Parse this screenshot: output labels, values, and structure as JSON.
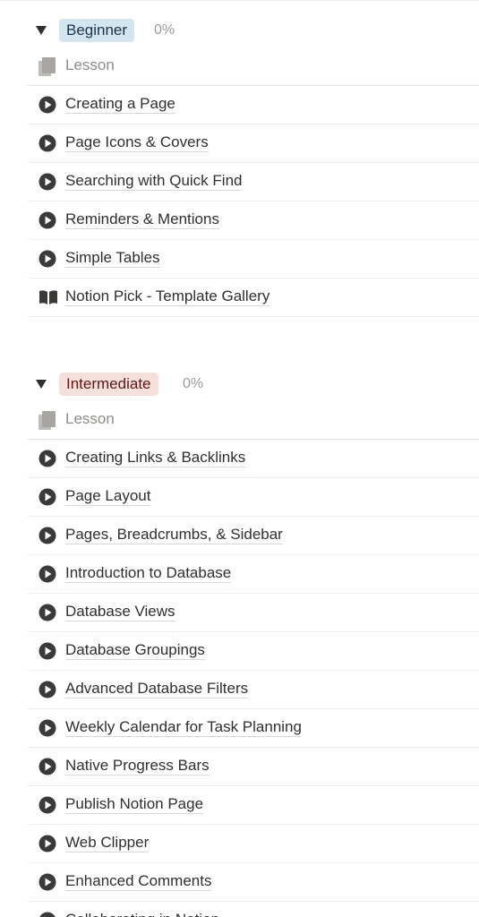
{
  "groups": [
    {
      "tag": "Beginner",
      "progress": "0%",
      "column_header": "Lesson",
      "items": [
        {
          "title": "Creating a Page",
          "icon": "play-circle-icon"
        },
        {
          "title": "Page Icons & Covers",
          "icon": "play-circle-icon"
        },
        {
          "title": "Searching with Quick Find",
          "icon": "play-circle-icon"
        },
        {
          "title": "Reminders & Mentions",
          "icon": "play-circle-icon"
        },
        {
          "title": "Simple Tables",
          "icon": "play-circle-icon"
        },
        {
          "title": "Notion Pick - Template Gallery",
          "icon": "open-book-icon"
        }
      ]
    },
    {
      "tag": "Intermediate",
      "progress": "0%",
      "column_header": "Lesson",
      "items": [
        {
          "title": "Creating Links & Backlinks",
          "icon": "play-circle-icon"
        },
        {
          "title": "Page Layout",
          "icon": "play-circle-icon"
        },
        {
          "title": "Pages, Breadcrumbs, & Sidebar",
          "icon": "play-circle-icon"
        },
        {
          "title": "Introduction to Database",
          "icon": "play-circle-icon"
        },
        {
          "title": "Database Views",
          "icon": "play-circle-icon"
        },
        {
          "title": "Database Groupings",
          "icon": "play-circle-icon"
        },
        {
          "title": "Advanced Database Filters",
          "icon": "play-circle-icon"
        },
        {
          "title": "Weekly Calendar for Task Planning",
          "icon": "play-circle-icon"
        },
        {
          "title": "Native Progress Bars",
          "icon": "play-circle-icon"
        },
        {
          "title": "Publish Notion Page",
          "icon": "play-circle-icon"
        },
        {
          "title": "Web Clipper",
          "icon": "play-circle-icon"
        },
        {
          "title": "Enhanced Comments",
          "icon": "play-circle-icon"
        },
        {
          "title": "Collaborating in Notion",
          "icon": "play-circle-icon"
        }
      ]
    }
  ]
}
